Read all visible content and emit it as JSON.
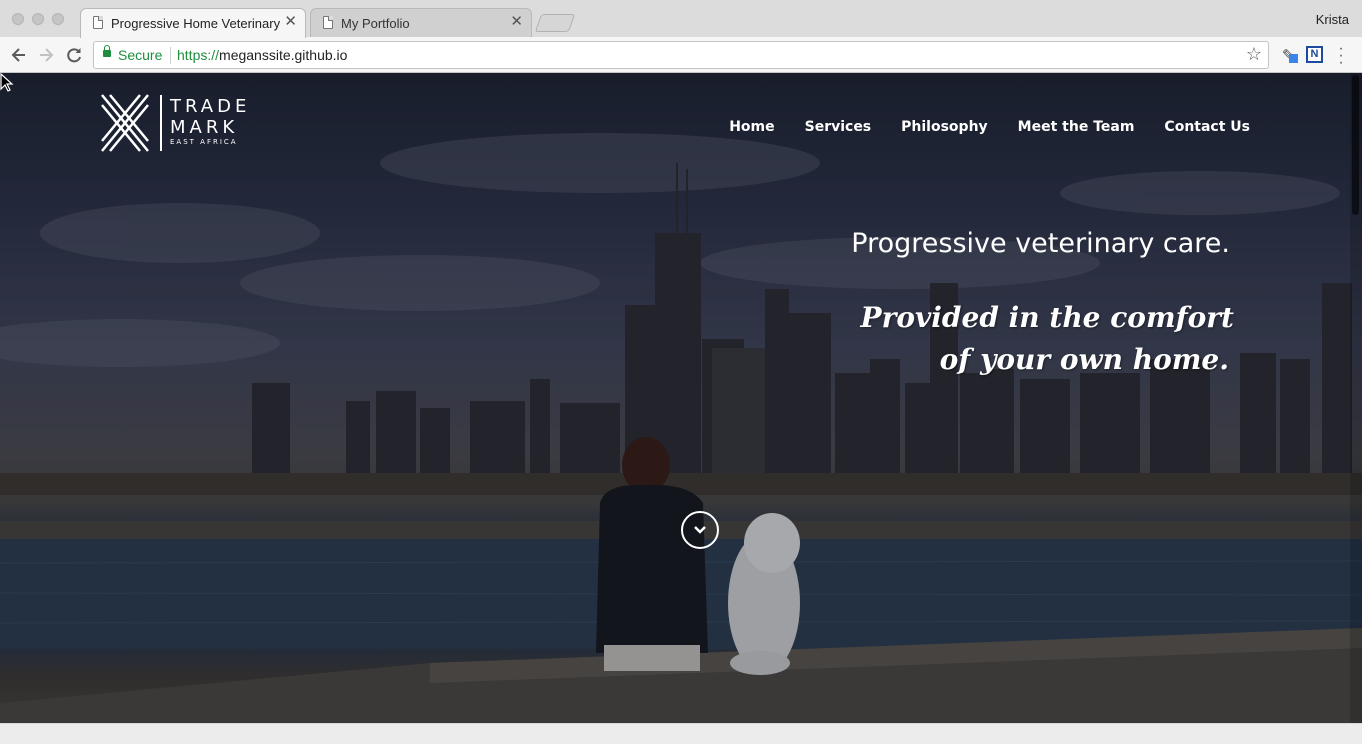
{
  "browser": {
    "tabs": [
      {
        "title": "Progressive Home Veterinary C",
        "active": true
      },
      {
        "title": "My Portfolio",
        "active": false
      }
    ],
    "profile_name": "Krista",
    "close_glyph": "✕",
    "security_label": "Secure",
    "url_scheme": "https://",
    "url_host": "meganssite.github.io",
    "icons": [
      "back-arrow-icon",
      "forward-arrow-icon",
      "reload-icon",
      "lock-icon",
      "star-icon",
      "pen-extension-icon",
      "n-extension-icon",
      "menu-dots-icon"
    ],
    "ext_n_label": "N"
  },
  "site": {
    "logo": {
      "line1": "TRADE",
      "line2": "MARK",
      "line3": "EAST AFRICA"
    },
    "nav": [
      "Home",
      "Services",
      "Philosophy",
      "Meet the Team",
      "Contact Us"
    ],
    "headline": "Progressive veterinary care.",
    "tagline_line1": "Provided in the comfort",
    "tagline_line2": "of your own home.",
    "scroll_icon": "chevron-down-icon"
  }
}
